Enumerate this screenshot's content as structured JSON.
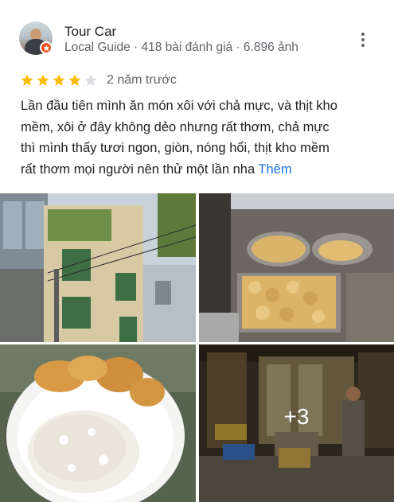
{
  "review": {
    "author_name": "Tour Car",
    "author_meta": "Local Guide · 418 bài đánh giá · 6.896 ảnh",
    "rating": 4,
    "rating_max": 5,
    "time": "2 năm trước",
    "text_lines": [
      "Lần đầu tiên mình ăn món xôi với chả mực, và thịt kho",
      "mềm, xôi ở đây không dẻo nhưng rất thơm, chả mực",
      "thì mình thấy tươi ngon, giòn, nóng hổi, thịt kho mềm",
      "rất thơm mọi người nên thử một lần nha"
    ],
    "more_label": "Thêm",
    "extra_photos_label": "+3"
  },
  "colors": {
    "star_filled": "#fbbc04",
    "star_empty": "#dadce0",
    "link": "#1a73e8",
    "badge": "#f4511e"
  },
  "icons": {
    "more": "more-vert-icon",
    "star": "star-icon",
    "badge": "local-guide-badge-icon"
  }
}
